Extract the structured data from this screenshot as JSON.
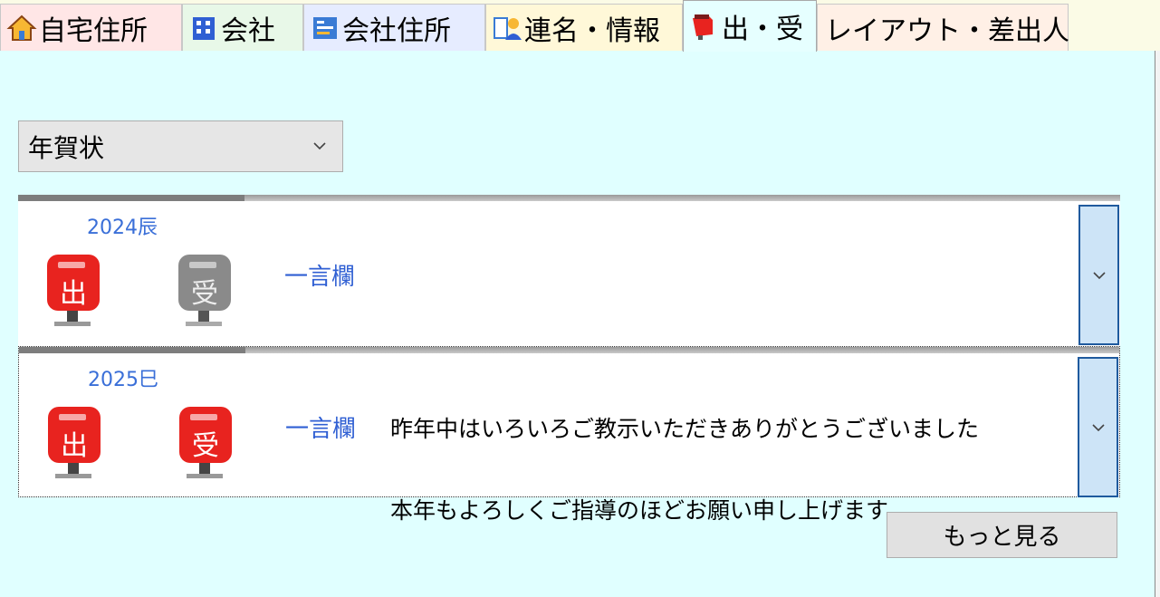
{
  "tabs": [
    {
      "label": "自宅住所",
      "icon": "house-icon",
      "bg": "#ffe6e6",
      "active": false
    },
    {
      "label": "会社",
      "icon": "company-icon",
      "bg": "#e8f8e8",
      "active": false
    },
    {
      "label": "会社住所",
      "icon": "company-address-icon",
      "bg": "#e6ecff",
      "active": false
    },
    {
      "label": "連名・情報",
      "icon": "people-info-icon",
      "bg": "#fff8d8",
      "active": false
    },
    {
      "label": "出・受",
      "icon": "postbox-icon",
      "bg": "#e6ffff",
      "active": true
    },
    {
      "label": "レイアウト・差出人",
      "icon": "layout-icon",
      "bg": "#fff0e6",
      "active": false
    }
  ],
  "type_select": {
    "value": "年賀状"
  },
  "records": [
    {
      "year": "2024辰",
      "sent_icon_label": "出",
      "received_icon_label": "受",
      "sent": true,
      "received": false,
      "hitokoto_label": "一言欄",
      "memo_line1": "",
      "memo_line2": ""
    },
    {
      "year": "2025巳",
      "sent_icon_label": "出",
      "received_icon_label": "受",
      "sent": true,
      "received": true,
      "hitokoto_label": "一言欄",
      "memo_line1": "昨年中はいろいろご教示いただきありがとうございました",
      "memo_line2": "本年もよろしくご指導のほどお願い申し上げます"
    }
  ],
  "more_button": "もっと見る",
  "colors": {
    "panel": "#e0ffff",
    "accent": "#2f5fd3",
    "postbox_red": "#e8231f",
    "postbox_gray": "#8a8a8a"
  }
}
